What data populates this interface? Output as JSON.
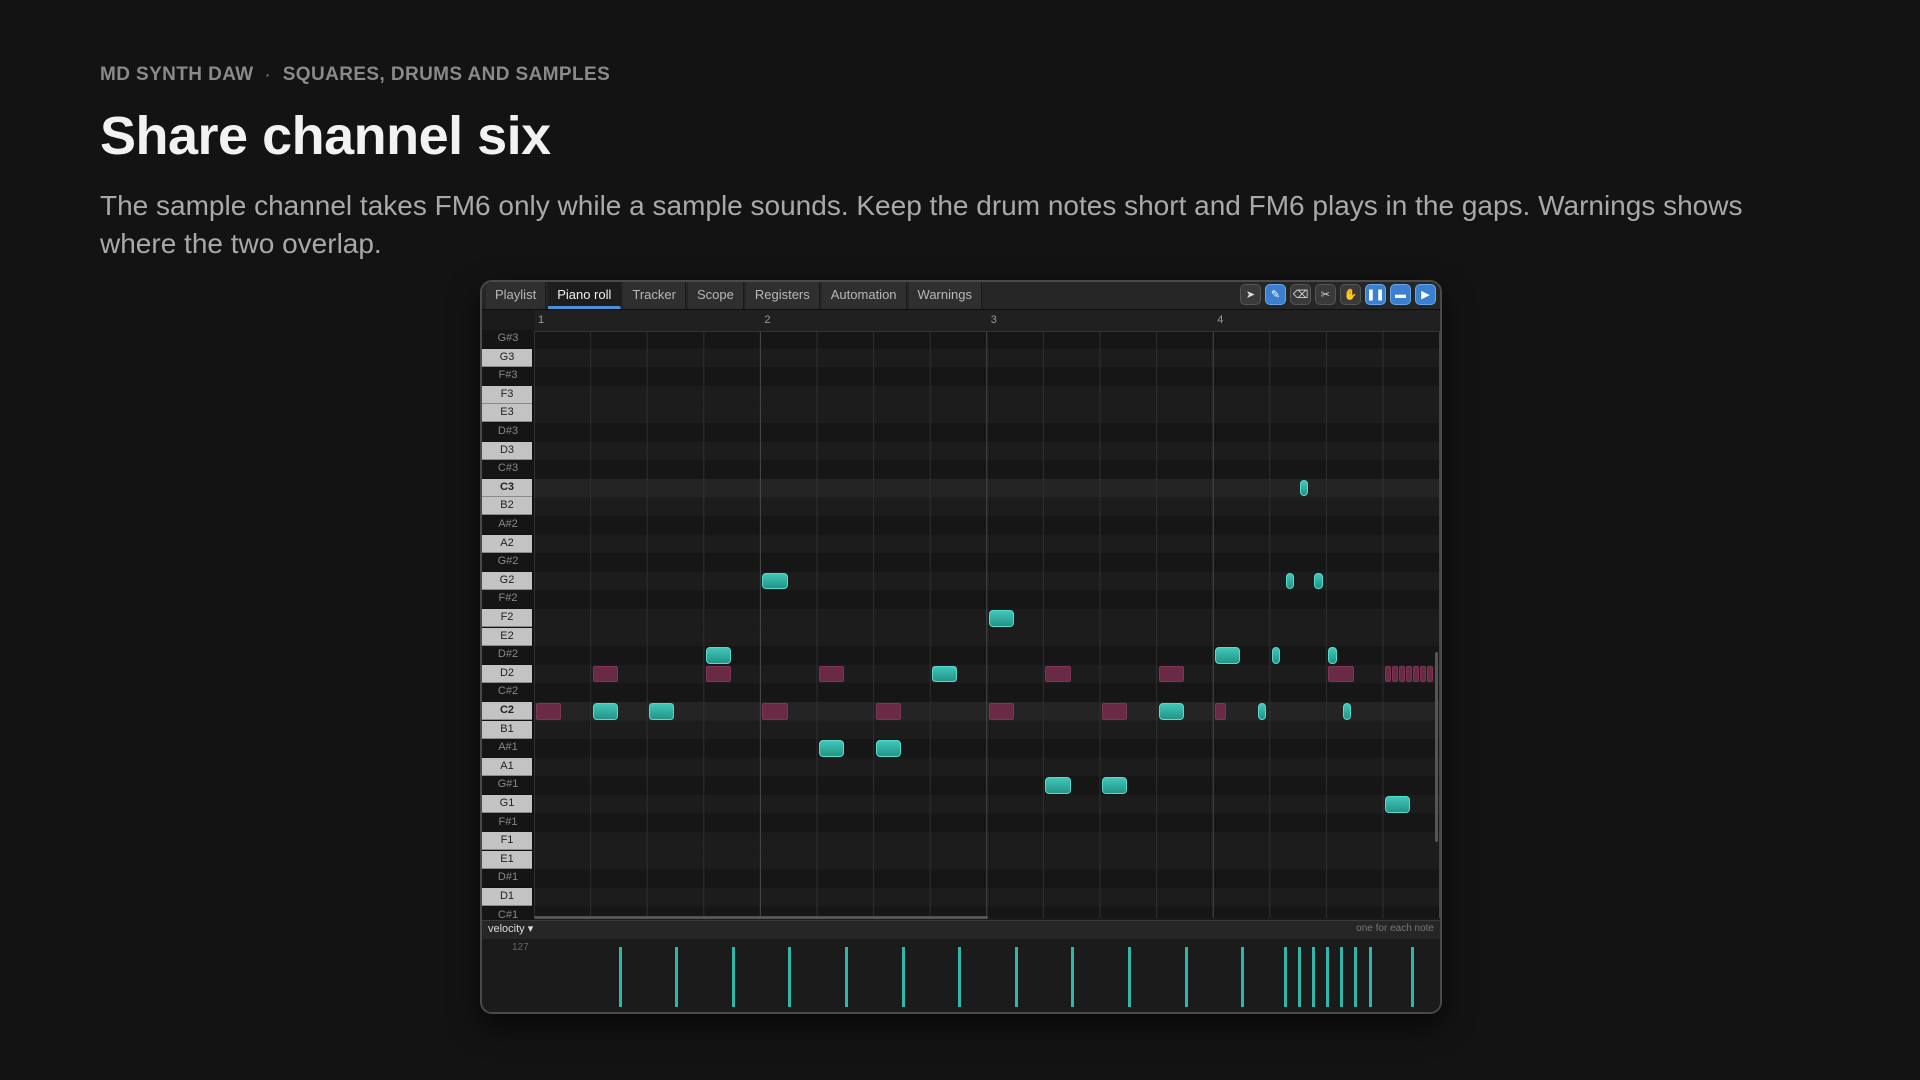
{
  "header": {
    "kicker_left": "MD SYNTH DAW",
    "kicker_sep": "·",
    "kicker_right": "SQUARES, DRUMS AND SAMPLES",
    "title": "Share channel six",
    "subtitle": "The sample channel takes FM6 only while a sample sounds. Keep the drum notes short and FM6 plays in the gaps. Warnings shows where the two overlap."
  },
  "tabs": [
    {
      "label": "Playlist",
      "active": false
    },
    {
      "label": "Piano roll",
      "active": true
    },
    {
      "label": "Tracker",
      "active": false
    },
    {
      "label": "Scope",
      "active": false
    },
    {
      "label": "Registers",
      "active": false
    },
    {
      "label": "Automation",
      "active": false
    },
    {
      "label": "Warnings",
      "active": false
    }
  ],
  "tools": [
    {
      "name": "select-tool",
      "glyph": "➤",
      "on": false
    },
    {
      "name": "pencil-tool",
      "glyph": "✎",
      "on": true
    },
    {
      "name": "eraser-tool",
      "glyph": "⌫",
      "on": false
    },
    {
      "name": "cut-tool",
      "glyph": "✂",
      "on": false
    },
    {
      "name": "hand-tool",
      "glyph": "✋",
      "on": false
    },
    {
      "name": "pause-button",
      "glyph": "❚❚",
      "on": true
    },
    {
      "name": "loop-button",
      "glyph": "▬",
      "on": true
    },
    {
      "name": "play-button",
      "glyph": "▶",
      "on": true
    }
  ],
  "ruler": {
    "bars": [
      "1",
      "2",
      "3",
      "4"
    ]
  },
  "keys": [
    "G#3",
    "G3",
    "F#3",
    "F3",
    "E3",
    "D#3",
    "D3",
    "C#3",
    "C3",
    "B2",
    "A#2",
    "A2",
    "G#2",
    "G2",
    "F#2",
    "F2",
    "E2",
    "D#2",
    "D2",
    "C#2",
    "C2",
    "B1",
    "A#1",
    "A1",
    "G#1",
    "G1",
    "F#1",
    "F1",
    "E1",
    "D#1",
    "D1",
    "C#1"
  ],
  "colors": {
    "fm_note": "#2fb8aa",
    "drum_note": "#6a2a45",
    "accent": "#4a8fd9"
  },
  "notes": {
    "fm": [
      {
        "pitch": "C2",
        "beat": 1.0,
        "len": 0.5
      },
      {
        "pitch": "C2",
        "beat": 2.0,
        "len": 0.5
      },
      {
        "pitch": "D#2",
        "beat": 3.0,
        "len": 0.5
      },
      {
        "pitch": "G2",
        "beat": 4.0,
        "len": 0.5
      },
      {
        "pitch": "A#1",
        "beat": 5.0,
        "len": 0.5
      },
      {
        "pitch": "A#1",
        "beat": 6.0,
        "len": 0.5
      },
      {
        "pitch": "D2",
        "beat": 7.0,
        "len": 0.5
      },
      {
        "pitch": "F2",
        "beat": 8.0,
        "len": 0.5
      },
      {
        "pitch": "G#1",
        "beat": 9.0,
        "len": 0.5
      },
      {
        "pitch": "G#1",
        "beat": 10.0,
        "len": 0.5
      },
      {
        "pitch": "C2",
        "beat": 11.0,
        "len": 0.5
      },
      {
        "pitch": "D#2",
        "beat": 12.0,
        "len": 0.5
      },
      {
        "pitch": "C2",
        "beat": 12.75,
        "len": 0.2
      },
      {
        "pitch": "D#2",
        "beat": 13.0,
        "len": 0.2
      },
      {
        "pitch": "G2",
        "beat": 13.25,
        "len": 0.2
      },
      {
        "pitch": "C3",
        "beat": 13.5,
        "len": 0.2
      },
      {
        "pitch": "G2",
        "beat": 13.75,
        "len": 0.2
      },
      {
        "pitch": "D#2",
        "beat": 14.0,
        "len": 0.2
      },
      {
        "pitch": "C2",
        "beat": 14.25,
        "len": 0.2
      },
      {
        "pitch": "G1",
        "beat": 15.0,
        "len": 0.5
      }
    ],
    "drum": [
      {
        "pitch": "C2",
        "beat": 0.0,
        "len": 0.5
      },
      {
        "pitch": "D2",
        "beat": 1.0,
        "len": 0.5
      },
      {
        "pitch": "C2",
        "beat": 2.0,
        "len": 0.5
      },
      {
        "pitch": "D2",
        "beat": 3.0,
        "len": 0.5
      },
      {
        "pitch": "C2",
        "beat": 4.0,
        "len": 0.5
      },
      {
        "pitch": "D2",
        "beat": 5.0,
        "len": 0.5
      },
      {
        "pitch": "C2",
        "beat": 6.0,
        "len": 0.5
      },
      {
        "pitch": "D2",
        "beat": 7.0,
        "len": 0.5
      },
      {
        "pitch": "C2",
        "beat": 8.0,
        "len": 0.5
      },
      {
        "pitch": "D2",
        "beat": 9.0,
        "len": 0.5
      },
      {
        "pitch": "C2",
        "beat": 10.0,
        "len": 0.5
      },
      {
        "pitch": "D2",
        "beat": 11.0,
        "len": 0.5
      },
      {
        "pitch": "C2",
        "beat": 12.0,
        "len": 0.25
      },
      {
        "pitch": "D2",
        "beat": 14.0,
        "len": 0.5
      },
      {
        "pitch": "D2",
        "beat": 15.0,
        "len": 0.125
      },
      {
        "pitch": "D2",
        "beat": 15.125,
        "len": 0.125
      },
      {
        "pitch": "D2",
        "beat": 15.25,
        "len": 0.125
      },
      {
        "pitch": "D2",
        "beat": 15.375,
        "len": 0.125
      },
      {
        "pitch": "D2",
        "beat": 15.5,
        "len": 0.125
      },
      {
        "pitch": "D2",
        "beat": 15.625,
        "len": 0.125
      },
      {
        "pitch": "D2",
        "beat": 15.75,
        "len": 0.125
      }
    ]
  },
  "velocity": {
    "selector": "velocity ▾",
    "hint": "one for each note",
    "max_label": "127"
  }
}
